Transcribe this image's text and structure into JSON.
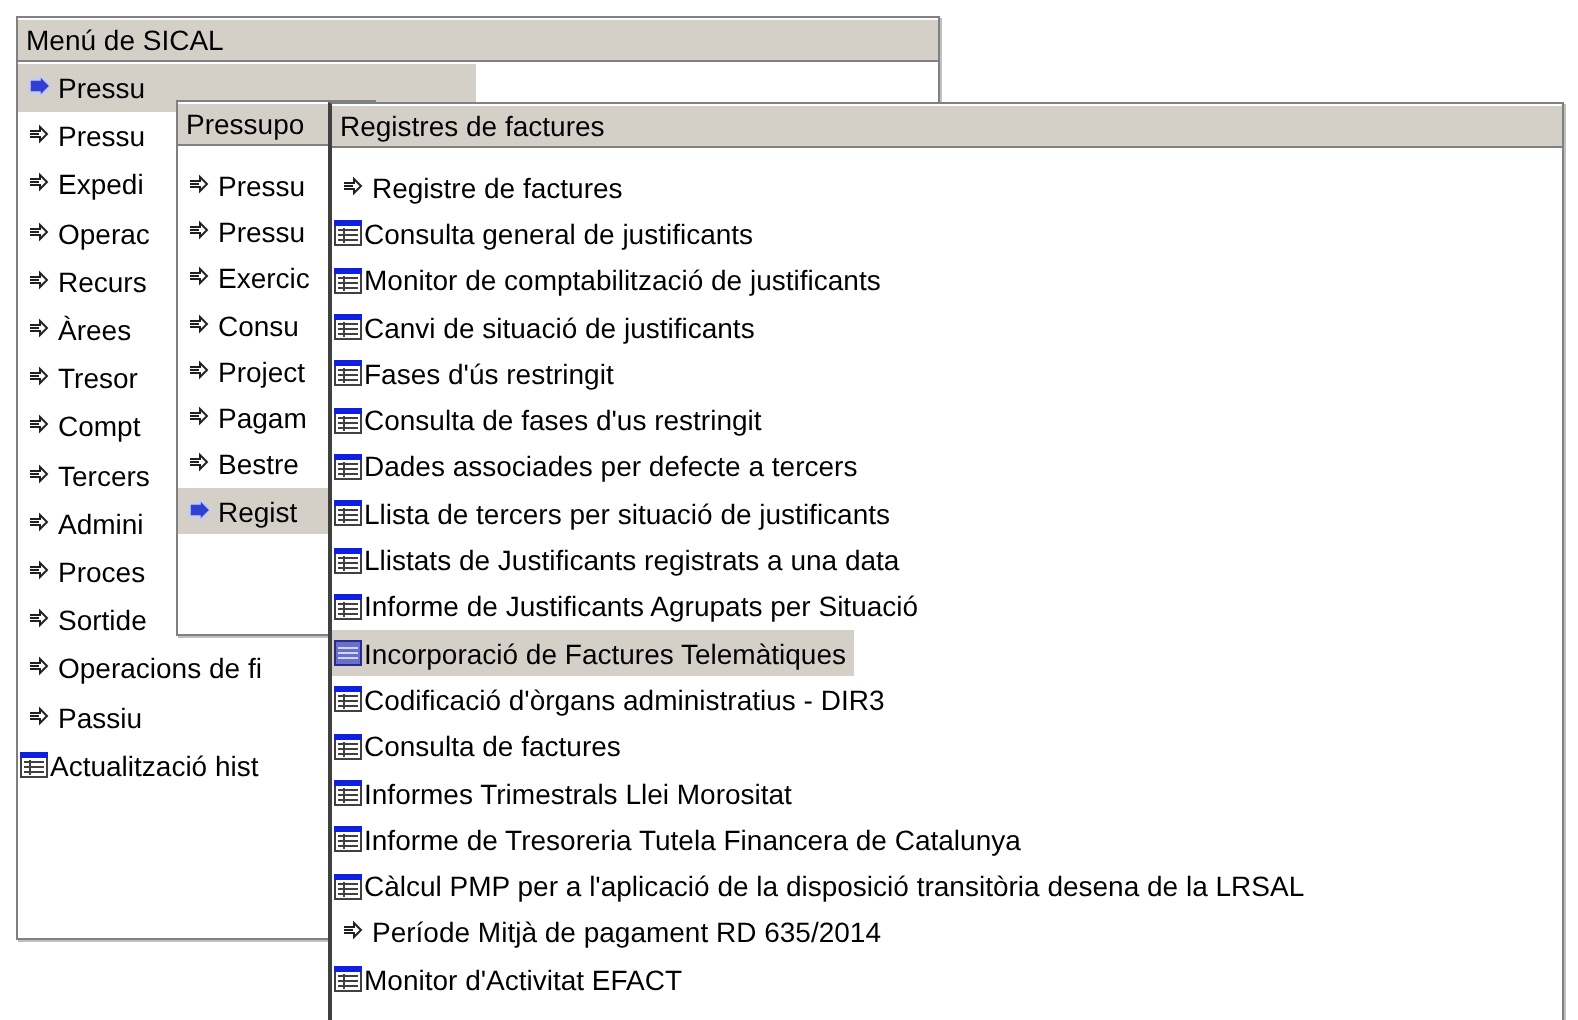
{
  "menus": [
    {
      "title": "Menú de SICAL",
      "items": [
        {
          "label": "Pressu",
          "kind": "submenu",
          "selected": true
        },
        {
          "label": "Pressu",
          "kind": "submenu",
          "selected": false
        },
        {
          "label": "Expedi",
          "kind": "submenu",
          "selected": false
        },
        {
          "label": "Operac",
          "kind": "submenu",
          "selected": false
        },
        {
          "label": "Recurs",
          "kind": "submenu",
          "selected": false
        },
        {
          "label": "Àrees",
          "kind": "submenu",
          "selected": false
        },
        {
          "label": "Tresor",
          "kind": "submenu",
          "selected": false
        },
        {
          "label": "Compt",
          "kind": "submenu",
          "selected": false
        },
        {
          "label": "Tercers",
          "kind": "submenu",
          "selected": false
        },
        {
          "label": "Admini",
          "kind": "submenu",
          "selected": false
        },
        {
          "label": "Proces",
          "kind": "submenu",
          "selected": false
        },
        {
          "label": "Sortide",
          "kind": "submenu",
          "selected": false
        },
        {
          "label": "Operacions de fi",
          "kind": "submenu",
          "selected": false
        },
        {
          "label": "Passiu",
          "kind": "submenu",
          "selected": false
        },
        {
          "label": "Actualització hist",
          "kind": "form",
          "selected": false
        }
      ]
    },
    {
      "title": "Pressupo",
      "items": [
        {
          "label": "Pressu",
          "kind": "submenu",
          "selected": false
        },
        {
          "label": "Pressu",
          "kind": "submenu",
          "selected": false
        },
        {
          "label": "Exercic",
          "kind": "submenu",
          "selected": false
        },
        {
          "label": "Consu",
          "kind": "submenu",
          "selected": false
        },
        {
          "label": "Project",
          "kind": "submenu",
          "selected": false
        },
        {
          "label": "Pagam",
          "kind": "submenu",
          "selected": false
        },
        {
          "label": "Bestre",
          "kind": "submenu",
          "selected": false
        },
        {
          "label": "Regist",
          "kind": "submenu",
          "selected": true
        }
      ]
    },
    {
      "title": "Registres de factures",
      "items": [
        {
          "label": "Registre de factures",
          "kind": "submenu",
          "selected": false
        },
        {
          "label": "Consulta general de justificants",
          "kind": "form",
          "selected": false
        },
        {
          "label": "Monitor de comptabilització de justificants",
          "kind": "form",
          "selected": false
        },
        {
          "label": "Canvi de situació de justificants",
          "kind": "form",
          "selected": false
        },
        {
          "label": "Fases d'ús restringit",
          "kind": "form",
          "selected": false
        },
        {
          "label": "Consulta de fases d'us restringit",
          "kind": "form",
          "selected": false
        },
        {
          "label": "Dades associades per defecte a tercers",
          "kind": "form",
          "selected": false
        },
        {
          "label": "Llista de tercers per situació de justificants",
          "kind": "form",
          "selected": false
        },
        {
          "label": "Llistats de Justificants registrats a una data",
          "kind": "form",
          "selected": false
        },
        {
          "label": "Informe de Justificants Agrupats per Situació",
          "kind": "form",
          "selected": false
        },
        {
          "label": "Incorporació de Factures Telemàtiques",
          "kind": "form",
          "selected": true
        },
        {
          "label": "Codificació d'òrgans administratius - DIR3",
          "kind": "form",
          "selected": false
        },
        {
          "label": "Consulta de factures",
          "kind": "form",
          "selected": false
        },
        {
          "label": "Informes Trimestrals Llei Morositat",
          "kind": "form",
          "selected": false
        },
        {
          "label": "Informe de Tresoreria Tutela Financera de Catalunya",
          "kind": "form",
          "selected": false
        },
        {
          "label": "Càlcul PMP per a l'aplicació de la disposició transitòria desena de la LRSAL",
          "kind": "form",
          "selected": false
        },
        {
          "label": "Període Mitjà de pagament RD 635/2014",
          "kind": "submenu",
          "selected": false
        },
        {
          "label": "Monitor d'Activitat EFACT",
          "kind": "form",
          "selected": false
        }
      ]
    }
  ]
}
